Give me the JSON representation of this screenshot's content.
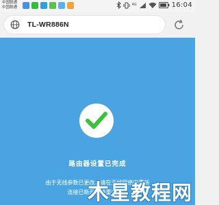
{
  "status_bar": {
    "carrier_line1": "中国联通",
    "carrier_line2": "中国联通",
    "signal_label": "4G",
    "time": "16:04",
    "app_icons": [
      "paper-plane-icon",
      "wechat-icon",
      "qq-icon",
      "message-icon",
      "image-icon",
      "apps-icon"
    ]
  },
  "browser": {
    "url": "TL-WR886N",
    "globe_icon": "globe-icon",
    "reload_icon": "reload-icon"
  },
  "content": {
    "title": "路由器设置已完成",
    "description_line1": "由于无线参数已更改，请在无线网络中重新",
    "description_line2": "连接已断开，请重新连接",
    "check_icon": "checkmark-icon",
    "colors": {
      "background": "#4ba4e2",
      "check": "#3cc13b"
    }
  },
  "watermark": {
    "mark": "木",
    "text": "星教程网"
  }
}
